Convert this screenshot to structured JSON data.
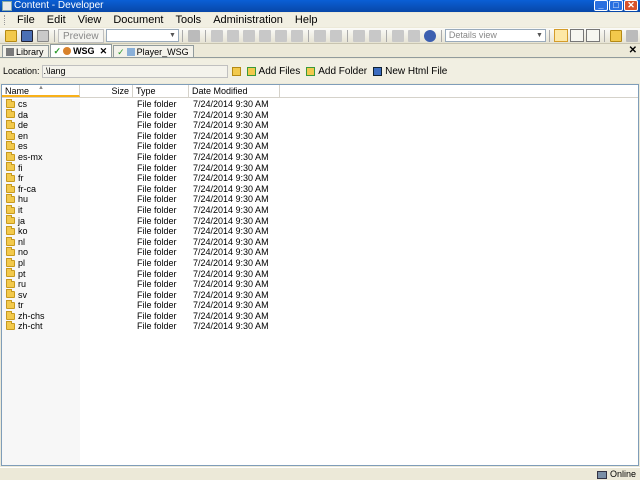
{
  "window": {
    "title": "Content - Developer",
    "buttons": {
      "minimize": "_",
      "maximize": "□",
      "close": "✕"
    }
  },
  "menu": [
    {
      "label": "File"
    },
    {
      "label": "Edit"
    },
    {
      "label": "View"
    },
    {
      "label": "Document"
    },
    {
      "label": "Tools"
    },
    {
      "label": "Administration"
    },
    {
      "label": "Help"
    }
  ],
  "toolbar": {
    "preview_label": "Preview",
    "view_mode": "Details view",
    "icons": [
      "open-icon",
      "save-icon",
      "print-icon",
      "preview-icon",
      "cut-icon",
      "copy-icon",
      "paste-icon",
      "delete-icon",
      "undo-icon",
      "redo-icon",
      "find-icon",
      "help-icon",
      "details-view-icon",
      "list-view-icon",
      "tiles-view-icon",
      "up-folder-icon",
      "refresh-icon"
    ]
  },
  "tabs": [
    {
      "label": "Library",
      "active": false
    },
    {
      "label": "WSG",
      "active": true,
      "close": "✕"
    },
    {
      "label": "Player_WSG",
      "active": false
    }
  ],
  "tabstrip_close": "✕",
  "location": {
    "label": "Location:",
    "value": ".\\lang",
    "actions": [
      {
        "label": "Add Files",
        "icon": "add-files-icon"
      },
      {
        "label": "Add Folder",
        "icon": "add-folder-icon"
      },
      {
        "label": "New Html File",
        "icon": "new-html-file-icon"
      }
    ]
  },
  "file_list": {
    "columns": [
      "Name",
      "Size",
      "Type",
      "Date Modified"
    ],
    "sort_column": "Name",
    "rows": [
      {
        "name": "cs",
        "size": "",
        "type": "File folder",
        "date": "7/24/2014 9:30 AM"
      },
      {
        "name": "da",
        "size": "",
        "type": "File folder",
        "date": "7/24/2014 9:30 AM"
      },
      {
        "name": "de",
        "size": "",
        "type": "File folder",
        "date": "7/24/2014 9:30 AM"
      },
      {
        "name": "en",
        "size": "",
        "type": "File folder",
        "date": "7/24/2014 9:30 AM"
      },
      {
        "name": "es",
        "size": "",
        "type": "File folder",
        "date": "7/24/2014 9:30 AM"
      },
      {
        "name": "es-mx",
        "size": "",
        "type": "File folder",
        "date": "7/24/2014 9:30 AM"
      },
      {
        "name": "fi",
        "size": "",
        "type": "File folder",
        "date": "7/24/2014 9:30 AM"
      },
      {
        "name": "fr",
        "size": "",
        "type": "File folder",
        "date": "7/24/2014 9:30 AM"
      },
      {
        "name": "fr-ca",
        "size": "",
        "type": "File folder",
        "date": "7/24/2014 9:30 AM"
      },
      {
        "name": "hu",
        "size": "",
        "type": "File folder",
        "date": "7/24/2014 9:30 AM"
      },
      {
        "name": "it",
        "size": "",
        "type": "File folder",
        "date": "7/24/2014 9:30 AM"
      },
      {
        "name": "ja",
        "size": "",
        "type": "File folder",
        "date": "7/24/2014 9:30 AM"
      },
      {
        "name": "ko",
        "size": "",
        "type": "File folder",
        "date": "7/24/2014 9:30 AM"
      },
      {
        "name": "nl",
        "size": "",
        "type": "File folder",
        "date": "7/24/2014 9:30 AM"
      },
      {
        "name": "no",
        "size": "",
        "type": "File folder",
        "date": "7/24/2014 9:30 AM"
      },
      {
        "name": "pl",
        "size": "",
        "type": "File folder",
        "date": "7/24/2014 9:30 AM"
      },
      {
        "name": "pt",
        "size": "",
        "type": "File folder",
        "date": "7/24/2014 9:30 AM"
      },
      {
        "name": "ru",
        "size": "",
        "type": "File folder",
        "date": "7/24/2014 9:30 AM"
      },
      {
        "name": "sv",
        "size": "",
        "type": "File folder",
        "date": "7/24/2014 9:30 AM"
      },
      {
        "name": "tr",
        "size": "",
        "type": "File folder",
        "date": "7/24/2014 9:30 AM"
      },
      {
        "name": "zh-chs",
        "size": "",
        "type": "File folder",
        "date": "7/24/2014 9:30 AM"
      },
      {
        "name": "zh-cht",
        "size": "",
        "type": "File folder",
        "date": "7/24/2014 9:30 AM"
      }
    ]
  },
  "status": {
    "connection": "Online"
  },
  "colors": {
    "titlebar": "#0a5fd6",
    "folder": "#f2c94c",
    "sort_highlight": "#f9b119"
  }
}
